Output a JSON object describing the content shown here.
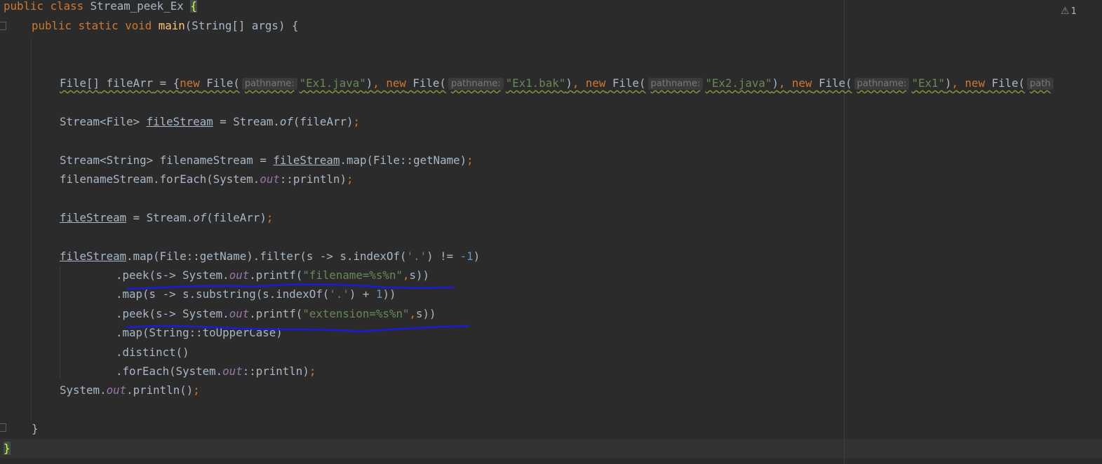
{
  "editor": {
    "language": "Java",
    "inspection_widget": {
      "icon": "warning-triangle-icon",
      "count": "1"
    },
    "hint_label": "pathname:",
    "lines": {
      "l1": {
        "kw1": "public",
        "kw2": "class",
        "cls": "Stream_peek_Ex",
        "brace": "{"
      },
      "l2": {
        "kw1": "public",
        "kw2": "static",
        "kw3": "void",
        "method": "main",
        "params": "(String[] args) {"
      },
      "l3": {
        "type": "File[]",
        "var": "fileArr",
        "eq": " = {",
        "new": "new",
        "file": "File(",
        "s1": "\"Ex1.java\"",
        "s2": "\"Ex1.bak\"",
        "s3": "\"Ex2.java\"",
        "s4": "\"Ex1\"",
        "close": ")",
        "comma": ",",
        "tail_hint": "path"
      },
      "l4": {
        "a": "Stream<File> ",
        "var": "fileStream",
        "b": " = Stream.",
        "of": "of",
        "c": "(fileArr)",
        "semi": ";"
      },
      "l5": {
        "a": "Stream<String> filenameStream = ",
        "var": "fileStream",
        "b": ".map(File::getName)",
        "semi": ";"
      },
      "l6": {
        "a": "filenameStream.forEach(System.",
        "out": "out",
        "b": "::println)",
        "semi": ";"
      },
      "l7": {
        "var": "fileStream",
        "a": " = Stream.",
        "of": "of",
        "b": "(fileArr)",
        "semi": ";"
      },
      "l8": {
        "var": "fileStream",
        "a": ".map(File::getName).filter(s -> s.indexOf(",
        "ch": "'.'",
        "b": ") != ",
        "num": "-1",
        "c": ")"
      },
      "l9": {
        "a": ".peek(s-> System.",
        "out": "out",
        "b": ".printf(",
        "str": "\"filename=%s%n\"",
        "comma": ",",
        "c": "s))"
      },
      "l10": {
        "a": ".map(s -> s.substring(s.indexOf(",
        "ch": "'.'",
        "b": ") + ",
        "num": "1",
        "c": "))"
      },
      "l11": {
        "a": ".peek(s-> System.",
        "out": "out",
        "b": ".printf(",
        "str": "\"extension=%s%n\"",
        "comma": ",",
        "c": "s))"
      },
      "l12": {
        "a": ".map(String::toUpperCase)"
      },
      "l13": {
        "a": ".distinct()"
      },
      "l14": {
        "a": ".forEach(System.",
        "out": "out",
        "b": "::println)",
        "semi": ";"
      },
      "l15": {
        "a": "System.",
        "out": "out",
        "b": ".println()",
        "semi": ";"
      },
      "l16": {
        "a": "}"
      },
      "l17": {
        "a": "}"
      }
    }
  }
}
